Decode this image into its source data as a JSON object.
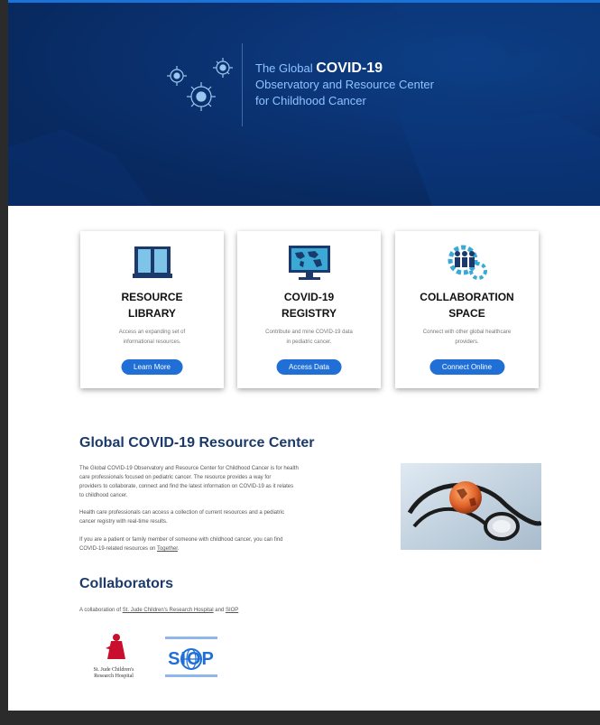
{
  "hero": {
    "line1_prefix": "The Global",
    "line1_strong": "COVID-19",
    "line2": "Observatory and Resource Center",
    "line3": "for Childhood Cancer"
  },
  "cards": [
    {
      "title_l1": "RESOURCE",
      "title_l2": "LIBRARY",
      "desc_l1": "Access an expanding set of",
      "desc_l2": "informational resources.",
      "button": "Learn More",
      "icon": "book-icon"
    },
    {
      "title_l1": "COVID-19",
      "title_l2": "REGISTRY",
      "desc_l1": "Contribute and mine COVID-19 data",
      "desc_l2": "in pediatric cancer.",
      "button": "Access Data",
      "icon": "world-monitor-icon"
    },
    {
      "title_l1": "COLLABORATION",
      "title_l2": "SPACE",
      "desc_l1": "Connect with other global healthcare",
      "desc_l2": "providers.",
      "button": "Connect Online",
      "icon": "people-gears-icon"
    }
  ],
  "resource_center": {
    "heading": "Global COVID-19 Resource Center",
    "p1_l1": "The Global COVID-19 Observatory and Resource Center for Childhood Cancer is for health",
    "p1_l2": "care professionals focused on pediatric cancer. The resource provides a way for",
    "p1_l3": "providers to collaborate, connect and find the latest information on COVID-19 as it relates",
    "p1_l4": "to childhood cancer.",
    "p2_l1": "Health care professionals can access a collection of current resources and a pediatric",
    "p2_l2": "cancer registry with real-time results.",
    "p3_l1": "If you are a patient or family member of someone with childhood cancer, you can find",
    "p3_l2": "COVID-19-related resources on",
    "p3_link": "Together",
    "p3_end": "."
  },
  "collaborators": {
    "heading": "Collaborators",
    "text_prefix": "A collaboration of",
    "link1": "St. Jude Children's Research Hospital",
    "text_mid": "and",
    "link2": "SIOP",
    "stjude_logo_l1": "St. Jude Children's",
    "stjude_logo_l2": "Research Hospital",
    "siop_logo": "SIOP"
  },
  "colors": {
    "hero_bg": "#0b3475",
    "accent_blue": "#1f6fd6",
    "heading_navy": "#1b3a6b"
  }
}
